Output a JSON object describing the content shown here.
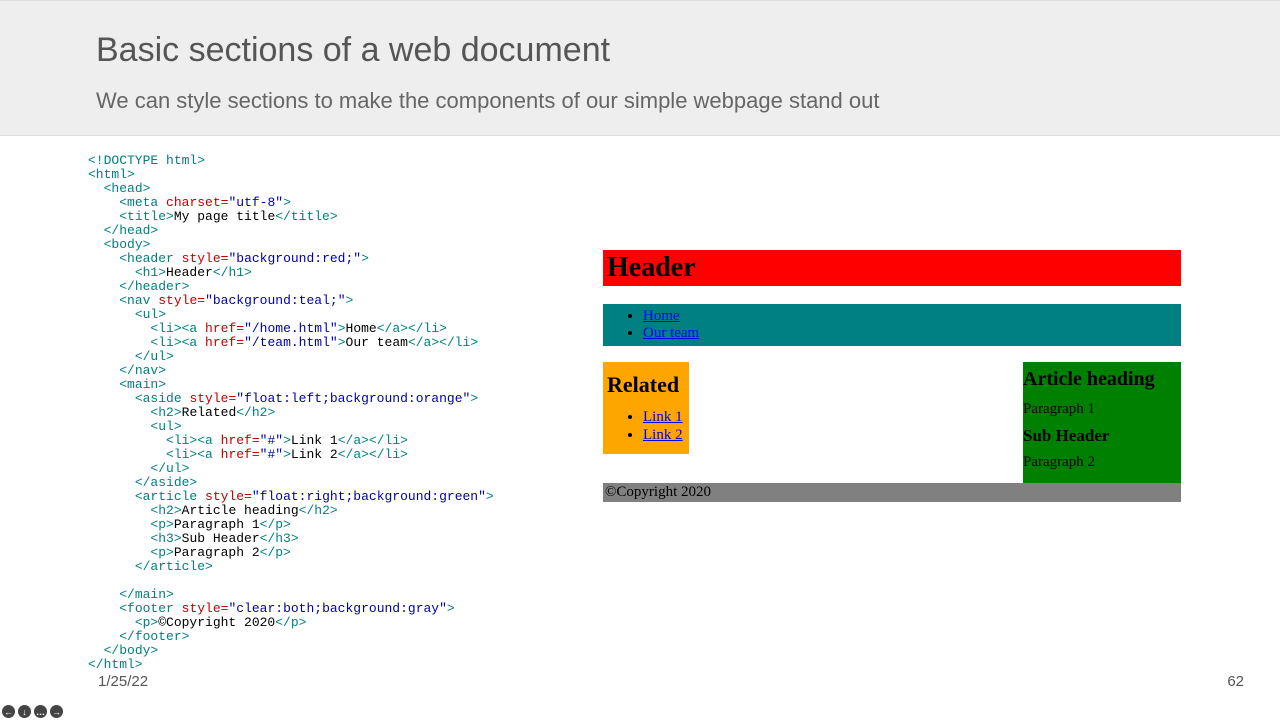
{
  "slide": {
    "title": "Basic sections of a web document",
    "subtitle": "We can style sections to make the components of our simple webpage stand out",
    "date": "1/25/22",
    "page_number": "62"
  },
  "code": {
    "doctype": "<!DOCTYPE html>",
    "page_title": "My page title",
    "header_style": "background:red;",
    "header_h1": "Header",
    "nav_style": "background:teal;",
    "nav_links": [
      {
        "href": "/home.html",
        "text": "Home"
      },
      {
        "href": "/team.html",
        "text": "Our team"
      }
    ],
    "aside_style": "float:left;background:orange",
    "aside_h2": "Related",
    "aside_links": [
      {
        "href": "#",
        "text": "Link 1"
      },
      {
        "href": "#",
        "text": "Link 2"
      }
    ],
    "article_style": "float:right;background:green",
    "article_h2": "Article heading",
    "article_p1": "Paragraph 1",
    "article_h3": "Sub Header",
    "article_p2": "Paragraph 2",
    "footer_style": "clear:both;background:gray",
    "footer_text": "©Copyright 2020"
  },
  "render": {
    "header": "Header",
    "nav": [
      "Home",
      "Our team"
    ],
    "aside_title": "Related",
    "aside_links": [
      "Link 1",
      "Link 2"
    ],
    "article_h2": "Article heading",
    "article_p1": "Paragraph 1",
    "article_h3": "Sub Header",
    "article_p2": "Paragraph 2",
    "footer": "©Copyright 2020"
  },
  "nav_icons": [
    "←",
    "↓",
    "…",
    "→"
  ]
}
